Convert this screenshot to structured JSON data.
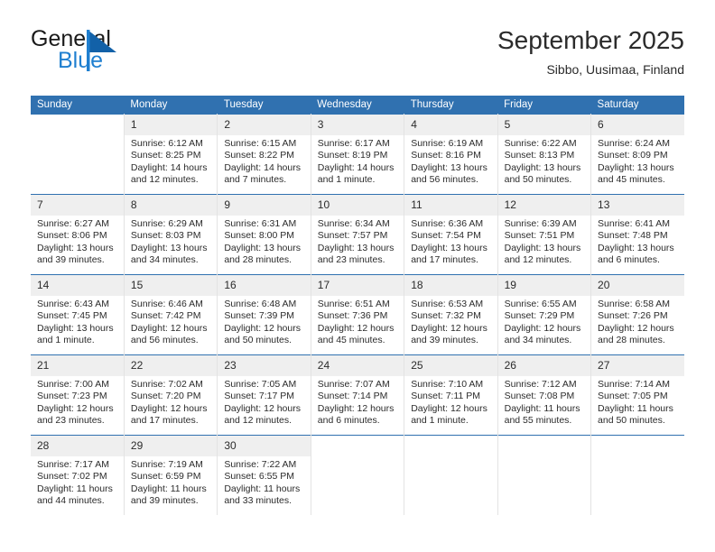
{
  "brand": {
    "word_one": "General",
    "word_two": "Blue",
    "mark_icon": "triangle-flag-icon",
    "accent_color": "#1f7fd0"
  },
  "header": {
    "title": "September 2025",
    "subtitle": "Sibbo, Uusimaa, Finland"
  },
  "calendar": {
    "header_bg": "#3071b0",
    "daynum_bg": "#efefef",
    "weekday_headers": [
      "Sunday",
      "Monday",
      "Tuesday",
      "Wednesday",
      "Thursday",
      "Friday",
      "Saturday"
    ],
    "weeks": [
      [
        {
          "day": "",
          "sunrise": "",
          "sunset": "",
          "daylight": ""
        },
        {
          "day": "1",
          "sunrise": "Sunrise: 6:12 AM",
          "sunset": "Sunset: 8:25 PM",
          "daylight": "Daylight: 14 hours and 12 minutes."
        },
        {
          "day": "2",
          "sunrise": "Sunrise: 6:15 AM",
          "sunset": "Sunset: 8:22 PM",
          "daylight": "Daylight: 14 hours and 7 minutes."
        },
        {
          "day": "3",
          "sunrise": "Sunrise: 6:17 AM",
          "sunset": "Sunset: 8:19 PM",
          "daylight": "Daylight: 14 hours and 1 minute."
        },
        {
          "day": "4",
          "sunrise": "Sunrise: 6:19 AM",
          "sunset": "Sunset: 8:16 PM",
          "daylight": "Daylight: 13 hours and 56 minutes."
        },
        {
          "day": "5",
          "sunrise": "Sunrise: 6:22 AM",
          "sunset": "Sunset: 8:13 PM",
          "daylight": "Daylight: 13 hours and 50 minutes."
        },
        {
          "day": "6",
          "sunrise": "Sunrise: 6:24 AM",
          "sunset": "Sunset: 8:09 PM",
          "daylight": "Daylight: 13 hours and 45 minutes."
        }
      ],
      [
        {
          "day": "7",
          "sunrise": "Sunrise: 6:27 AM",
          "sunset": "Sunset: 8:06 PM",
          "daylight": "Daylight: 13 hours and 39 minutes."
        },
        {
          "day": "8",
          "sunrise": "Sunrise: 6:29 AM",
          "sunset": "Sunset: 8:03 PM",
          "daylight": "Daylight: 13 hours and 34 minutes."
        },
        {
          "day": "9",
          "sunrise": "Sunrise: 6:31 AM",
          "sunset": "Sunset: 8:00 PM",
          "daylight": "Daylight: 13 hours and 28 minutes."
        },
        {
          "day": "10",
          "sunrise": "Sunrise: 6:34 AM",
          "sunset": "Sunset: 7:57 PM",
          "daylight": "Daylight: 13 hours and 23 minutes."
        },
        {
          "day": "11",
          "sunrise": "Sunrise: 6:36 AM",
          "sunset": "Sunset: 7:54 PM",
          "daylight": "Daylight: 13 hours and 17 minutes."
        },
        {
          "day": "12",
          "sunrise": "Sunrise: 6:39 AM",
          "sunset": "Sunset: 7:51 PM",
          "daylight": "Daylight: 13 hours and 12 minutes."
        },
        {
          "day": "13",
          "sunrise": "Sunrise: 6:41 AM",
          "sunset": "Sunset: 7:48 PM",
          "daylight": "Daylight: 13 hours and 6 minutes."
        }
      ],
      [
        {
          "day": "14",
          "sunrise": "Sunrise: 6:43 AM",
          "sunset": "Sunset: 7:45 PM",
          "daylight": "Daylight: 13 hours and 1 minute."
        },
        {
          "day": "15",
          "sunrise": "Sunrise: 6:46 AM",
          "sunset": "Sunset: 7:42 PM",
          "daylight": "Daylight: 12 hours and 56 minutes."
        },
        {
          "day": "16",
          "sunrise": "Sunrise: 6:48 AM",
          "sunset": "Sunset: 7:39 PM",
          "daylight": "Daylight: 12 hours and 50 minutes."
        },
        {
          "day": "17",
          "sunrise": "Sunrise: 6:51 AM",
          "sunset": "Sunset: 7:36 PM",
          "daylight": "Daylight: 12 hours and 45 minutes."
        },
        {
          "day": "18",
          "sunrise": "Sunrise: 6:53 AM",
          "sunset": "Sunset: 7:32 PM",
          "daylight": "Daylight: 12 hours and 39 minutes."
        },
        {
          "day": "19",
          "sunrise": "Sunrise: 6:55 AM",
          "sunset": "Sunset: 7:29 PM",
          "daylight": "Daylight: 12 hours and 34 minutes."
        },
        {
          "day": "20",
          "sunrise": "Sunrise: 6:58 AM",
          "sunset": "Sunset: 7:26 PM",
          "daylight": "Daylight: 12 hours and 28 minutes."
        }
      ],
      [
        {
          "day": "21",
          "sunrise": "Sunrise: 7:00 AM",
          "sunset": "Sunset: 7:23 PM",
          "daylight": "Daylight: 12 hours and 23 minutes."
        },
        {
          "day": "22",
          "sunrise": "Sunrise: 7:02 AM",
          "sunset": "Sunset: 7:20 PM",
          "daylight": "Daylight: 12 hours and 17 minutes."
        },
        {
          "day": "23",
          "sunrise": "Sunrise: 7:05 AM",
          "sunset": "Sunset: 7:17 PM",
          "daylight": "Daylight: 12 hours and 12 minutes."
        },
        {
          "day": "24",
          "sunrise": "Sunrise: 7:07 AM",
          "sunset": "Sunset: 7:14 PM",
          "daylight": "Daylight: 12 hours and 6 minutes."
        },
        {
          "day": "25",
          "sunrise": "Sunrise: 7:10 AM",
          "sunset": "Sunset: 7:11 PM",
          "daylight": "Daylight: 12 hours and 1 minute."
        },
        {
          "day": "26",
          "sunrise": "Sunrise: 7:12 AM",
          "sunset": "Sunset: 7:08 PM",
          "daylight": "Daylight: 11 hours and 55 minutes."
        },
        {
          "day": "27",
          "sunrise": "Sunrise: 7:14 AM",
          "sunset": "Sunset: 7:05 PM",
          "daylight": "Daylight: 11 hours and 50 minutes."
        }
      ],
      [
        {
          "day": "28",
          "sunrise": "Sunrise: 7:17 AM",
          "sunset": "Sunset: 7:02 PM",
          "daylight": "Daylight: 11 hours and 44 minutes."
        },
        {
          "day": "29",
          "sunrise": "Sunrise: 7:19 AM",
          "sunset": "Sunset: 6:59 PM",
          "daylight": "Daylight: 11 hours and 39 minutes."
        },
        {
          "day": "30",
          "sunrise": "Sunrise: 7:22 AM",
          "sunset": "Sunset: 6:55 PM",
          "daylight": "Daylight: 11 hours and 33 minutes."
        },
        {
          "day": "",
          "sunrise": "",
          "sunset": "",
          "daylight": ""
        },
        {
          "day": "",
          "sunrise": "",
          "sunset": "",
          "daylight": ""
        },
        {
          "day": "",
          "sunrise": "",
          "sunset": "",
          "daylight": ""
        },
        {
          "day": "",
          "sunrise": "",
          "sunset": "",
          "daylight": ""
        }
      ]
    ]
  }
}
